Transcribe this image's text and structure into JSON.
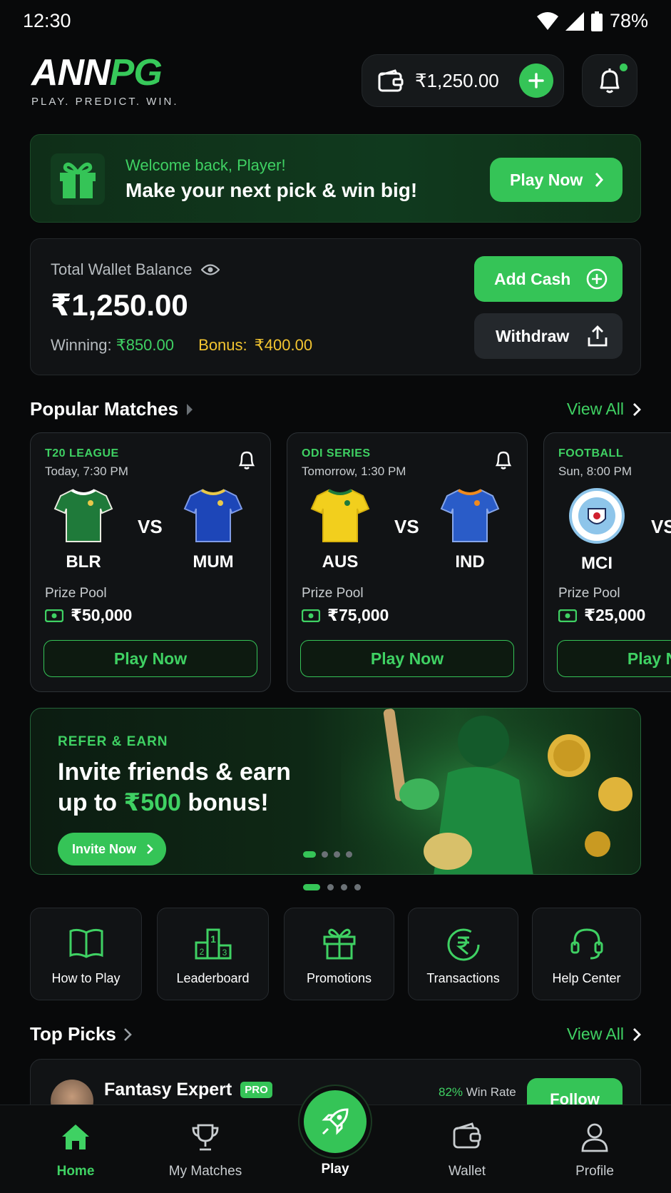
{
  "status_bar": {
    "time": "12:30",
    "battery": "78%"
  },
  "header": {
    "logo_part1": "ANN",
    "logo_part2": "PG",
    "tagline": "PLAY. PREDICT. WIN.",
    "wallet_amount": "₹1,250.00"
  },
  "welcome": {
    "greeting": "Welcome back, Player!",
    "message": "Make your next pick & win big!",
    "cta": "Play Now"
  },
  "wallet": {
    "label": "Total Wallet Balance",
    "balance": "₹1,250.00",
    "winning_label": "Winning:",
    "winning_value": "₹850.00",
    "bonus_label": "Bonus:",
    "bonus_value": "₹400.00",
    "add_cash": "Add Cash",
    "withdraw": "Withdraw"
  },
  "popular": {
    "title": "Popular Matches",
    "view_all": "View All",
    "prize_label": "Prize Pool",
    "play_label": "Play Now",
    "vs": "VS",
    "matches": [
      {
        "league": "T20 LEAGUE",
        "time": "Today, 7:30 PM",
        "team1": "BLR",
        "team2": "MUM",
        "prize": "₹50,000",
        "color1": "#1f7a3a",
        "color2": "#1d46b8"
      },
      {
        "league": "ODI SERIES",
        "time": "Tomorrow, 1:30 PM",
        "team1": "AUS",
        "team2": "IND",
        "prize": "₹75,000",
        "color1": "#f2cf1d",
        "color2": "#2a5cc8"
      },
      {
        "league": "FOOTBALL",
        "time": "Sun, 8:00 PM",
        "team1": "MCI",
        "team2": "",
        "prize": "₹25,000",
        "color1": "#8ec5ea",
        "color2": "#2a5cc8"
      }
    ]
  },
  "refer": {
    "tag": "REFER & EARN",
    "line1": "Invite friends & earn",
    "line2_pre": "up to ",
    "line2_amount": "₹500",
    "line2_post": " bonus!",
    "cta": "Invite Now"
  },
  "quick_links": [
    {
      "label": "How to Play",
      "icon": "book-icon"
    },
    {
      "label": "Leaderboard",
      "icon": "podium-icon"
    },
    {
      "label": "Promotions",
      "icon": "gift-icon"
    },
    {
      "label": "Transactions",
      "icon": "rupee-icon"
    },
    {
      "label": "Help Center",
      "icon": "headset-icon"
    }
  ],
  "top_picks": {
    "title": "Top Picks",
    "view_all": "View All",
    "expert_name": "Fantasy Expert",
    "badge": "PRO",
    "win_rate_value": "82%",
    "win_rate_label": "Win Rate",
    "follow": "Follow"
  },
  "nav": {
    "home": "Home",
    "my_matches": "My Matches",
    "play": "Play",
    "wallet": "Wallet",
    "profile": "Profile"
  },
  "colors": {
    "accent": "#35c457",
    "bonus": "#f3c531",
    "background": "#08090a"
  }
}
